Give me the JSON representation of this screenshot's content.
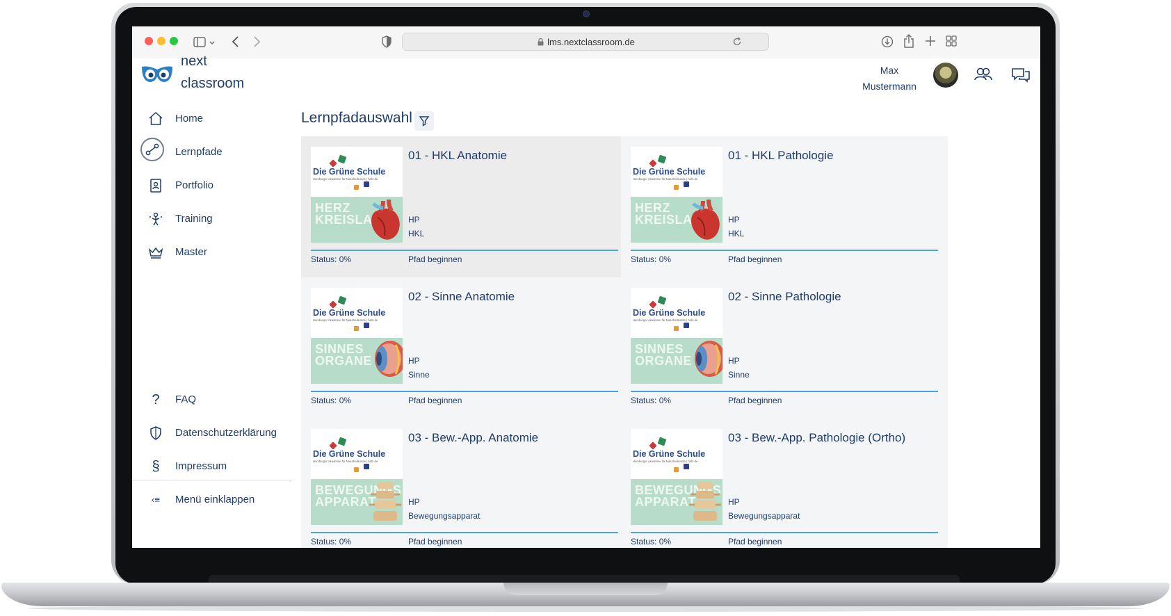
{
  "browser": {
    "url": "lms.nextclassroom.de"
  },
  "brand": {
    "line1": "next",
    "line2": "classroom"
  },
  "user": {
    "first_name": "Max",
    "last_name": "Mustermann"
  },
  "sidebar": {
    "items": [
      {
        "label": "Home",
        "icon": "home-icon"
      },
      {
        "label": "Lernpfade",
        "icon": "learning-path-icon",
        "active": true
      },
      {
        "label": "Portfolio",
        "icon": "portfolio-icon"
      },
      {
        "label": "Training",
        "icon": "training-icon"
      },
      {
        "label": "Master",
        "icon": "crown-icon"
      }
    ],
    "footer_items": [
      {
        "label": "FAQ",
        "icon": "question-icon"
      },
      {
        "label": "Datenschutzerklärung",
        "icon": "shield-icon"
      },
      {
        "label": "Impressum",
        "icon": "section-sign-icon"
      }
    ],
    "collapse_label": "Menü einklappen"
  },
  "main": {
    "title": "Lernpfadauswahl",
    "school_name": "Die Grüne Schule",
    "school_tagline": "Hamburger Akademie für Naturheilkunde | hafn.de",
    "cards": [
      {
        "title": "01 - HKL Anatomie",
        "tag1": "HP",
        "tag2": "HKL",
        "status": "Status: 0%",
        "action": "Pfad beginnen",
        "band_line1": "HERZ",
        "band_line2": "KREISLAUF",
        "progress": 0,
        "image": "heart"
      },
      {
        "title": "01 - HKL Pathologie",
        "tag1": "HP",
        "tag2": "HKL",
        "status": "Status: 0%",
        "action": "Pfad beginnen",
        "band_line1": "HERZ",
        "band_line2": "KREISLAUF",
        "progress": 0,
        "image": "heart"
      },
      {
        "title": "02 - Sinne Anatomie",
        "tag1": "HP",
        "tag2": "Sinne",
        "status": "Status: 0%",
        "action": "Pfad beginnen",
        "band_line1": "SINNES",
        "band_line2": "ORGANE",
        "progress": 0,
        "image": "eye"
      },
      {
        "title": "02 - Sinne Pathologie",
        "tag1": "HP",
        "tag2": "Sinne",
        "status": "Status: 0%",
        "action": "Pfad beginnen",
        "band_line1": "SINNES",
        "band_line2": "ORGANE",
        "progress": 0,
        "image": "eye"
      },
      {
        "title": "03 - Bew.-App. Anatomie",
        "tag1": "HP",
        "tag2": "Bewegungsapparat",
        "status": "Status: 0%",
        "action": "Pfad beginnen",
        "band_line1": "BEWEGUNGS",
        "band_line2": "APPARAT",
        "progress": 0,
        "image": "spine"
      },
      {
        "title": "03 - Bew.-App. Pathologie (Ortho)",
        "tag1": "HP",
        "tag2": "Bewegungsapparat",
        "status": "Status: 0%",
        "action": "Pfad beginnen",
        "band_line1": "BEWEGUNGS",
        "band_line2": "APPARAT",
        "progress": 0,
        "image": "spine"
      }
    ]
  }
}
